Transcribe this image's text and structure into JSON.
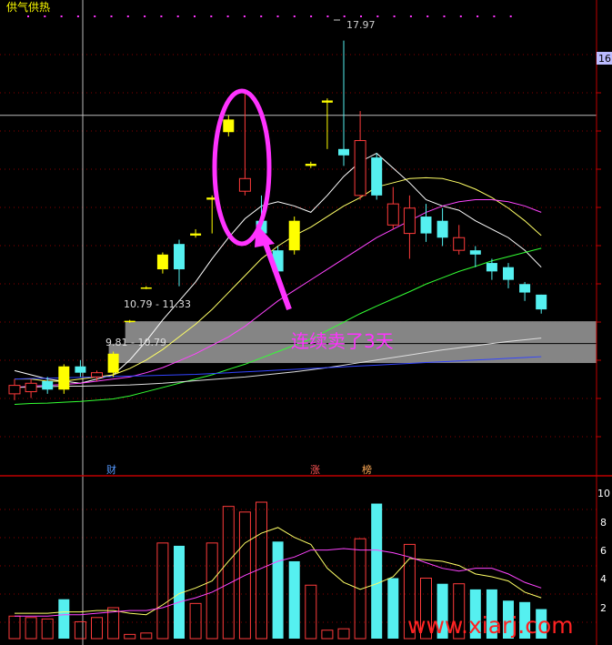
{
  "header": {
    "title": "供气供热",
    "title_color": "#ffff00"
  },
  "colors": {
    "up_candle": "#ff3b3b",
    "down_candle": "#55f0f0",
    "yellow_candle": "#ffff00",
    "ma5": "#ffffff",
    "ma10": "#ffff66",
    "ma20": "#ff44ff",
    "ma60": "#33ff33",
    "ma120": "#dddddd",
    "ma250": "#3344ff",
    "annotation": "#ff33ff",
    "grid": "#8a0000",
    "axis": "#c00000",
    "zone": "#8c8c8c"
  },
  "price_axis": {
    "tag": "16.",
    "ylim": [
      8.8,
      18.5
    ],
    "ticks": []
  },
  "volume_axis": {
    "ticks": [
      "10",
      "8",
      "6",
      "4",
      "2"
    ],
    "ylim": [
      0,
      10.8
    ]
  },
  "markers": [
    {
      "label": "财",
      "color": "#5599ff",
      "index": 7
    },
    {
      "label": "涨",
      "color": "#ff5555",
      "index": 21
    },
    {
      "label": "榜",
      "color": "#ffaa55",
      "index": 24
    }
  ],
  "annotation": {
    "text": "连续卖了3天"
  },
  "high_label": "17.97",
  "watermark": "www.xiarj.com",
  "chart_data": [
    {
      "type": "candlestick",
      "zones": [
        {
          "label": "10.79 - 11.33",
          "low": 10.79,
          "high": 11.33,
          "from_index": 7
        },
        {
          "label": "9.81 - 10.79",
          "low": 10.33,
          "high": 10.79,
          "from_index": 6
        }
      ],
      "reference_line": 16.2,
      "candles": [
        {
          "o": 9.6,
          "c": 9.8,
          "h": 9.95,
          "l": 9.45,
          "color": "up"
        },
        {
          "o": 9.65,
          "c": 9.85,
          "h": 9.95,
          "l": 9.5,
          "color": "up"
        },
        {
          "o": 9.9,
          "c": 9.7,
          "h": 10.0,
          "l": 9.6,
          "color": "down"
        },
        {
          "o": 9.7,
          "c": 10.25,
          "h": 10.3,
          "l": 9.6,
          "color": "yellow"
        },
        {
          "o": 10.25,
          "c": 10.1,
          "h": 10.4,
          "l": 10.0,
          "color": "down"
        },
        {
          "o": 10.0,
          "c": 10.1,
          "h": 10.15,
          "l": 9.9,
          "color": "up"
        },
        {
          "o": 10.1,
          "c": 10.55,
          "h": 10.6,
          "l": 10.0,
          "color": "yellow"
        },
        {
          "o": 11.31,
          "c": 11.33,
          "h": 11.35,
          "l": 11.28,
          "color": "yellow"
        },
        {
          "o": 12.1,
          "c": 12.12,
          "h": 12.15,
          "l": 12.08,
          "color": "yellow"
        },
        {
          "o": 12.55,
          "c": 12.9,
          "h": 12.95,
          "l": 12.45,
          "color": "yellow"
        },
        {
          "o": 13.15,
          "c": 12.55,
          "h": 13.25,
          "l": 12.15,
          "color": "down"
        },
        {
          "o": 13.35,
          "c": 13.4,
          "h": 13.5,
          "l": 13.3,
          "color": "yellow"
        },
        {
          "o": 14.2,
          "c": 14.25,
          "h": 14.3,
          "l": 13.4,
          "color": "yellow"
        },
        {
          "o": 15.8,
          "c": 16.1,
          "h": 16.2,
          "l": 15.7,
          "color": "yellow"
        },
        {
          "o": 14.7,
          "c": 14.4,
          "h": 16.8,
          "l": 14.3,
          "color": "up"
        },
        {
          "o": 13.7,
          "c": 13.4,
          "h": 14.3,
          "l": 13.3,
          "color": "down"
        },
        {
          "o": 13.0,
          "c": 12.5,
          "h": 13.1,
          "l": 12.4,
          "color": "down"
        },
        {
          "o": 13.7,
          "c": 13.0,
          "h": 13.8,
          "l": 12.9,
          "color": "yellow"
        },
        {
          "o": 15.0,
          "c": 15.05,
          "h": 15.1,
          "l": 14.95,
          "color": "yellow"
        },
        {
          "o": 16.5,
          "c": 16.55,
          "h": 16.6,
          "l": 15.4,
          "color": "yellow"
        },
        {
          "o": 15.4,
          "c": 15.25,
          "h": 17.97,
          "l": 15.0,
          "color": "down"
        },
        {
          "o": 14.3,
          "c": 15.6,
          "h": 16.3,
          "l": 14.2,
          "color": "up"
        },
        {
          "o": 15.2,
          "c": 14.3,
          "h": 15.3,
          "l": 14.2,
          "color": "down"
        },
        {
          "o": 13.6,
          "c": 14.1,
          "h": 14.5,
          "l": 13.5,
          "color": "up"
        },
        {
          "o": 13.4,
          "c": 14.0,
          "h": 14.3,
          "l": 12.8,
          "color": "up"
        },
        {
          "o": 13.8,
          "c": 13.4,
          "h": 14.1,
          "l": 13.2,
          "color": "down"
        },
        {
          "o": 13.7,
          "c": 13.3,
          "h": 14.0,
          "l": 13.1,
          "color": "down"
        },
        {
          "o": 13.0,
          "c": 13.3,
          "h": 13.6,
          "l": 12.9,
          "color": "up"
        },
        {
          "o": 13.0,
          "c": 12.9,
          "h": 13.1,
          "l": 12.6,
          "color": "down"
        },
        {
          "o": 12.7,
          "c": 12.5,
          "h": 12.8,
          "l": 12.3,
          "color": "down"
        },
        {
          "o": 12.6,
          "c": 12.3,
          "h": 12.7,
          "l": 12.1,
          "color": "down"
        },
        {
          "o": 12.2,
          "c": 12.0,
          "h": 12.25,
          "l": 11.8,
          "color": "down"
        },
        {
          "o": 11.95,
          "c": 11.6,
          "h": 11.95,
          "l": 11.5,
          "color": "down"
        }
      ],
      "moving_averages": [
        {
          "name": "MA5",
          "color": "#ffffff",
          "values": [
            10.15,
            10.05,
            9.95,
            9.9,
            9.85,
            9.95,
            10.05,
            10.4,
            10.85,
            11.35,
            11.8,
            12.25,
            12.8,
            13.3,
            13.75,
            14.05,
            14.15,
            14.05,
            13.9,
            14.3,
            14.75,
            15.1,
            15.3,
            14.95,
            14.6,
            14.2,
            14.05,
            13.95,
            13.7,
            13.5,
            13.3,
            13.0,
            12.6
          ]
        },
        {
          "name": "MA10",
          "color": "#ffff66",
          "values": [
            9.95,
            9.95,
            9.9,
            9.9,
            9.95,
            10.0,
            10.05,
            10.2,
            10.4,
            10.65,
            10.95,
            11.25,
            11.6,
            12.0,
            12.4,
            12.8,
            13.1,
            13.35,
            13.55,
            13.8,
            14.05,
            14.25,
            14.5,
            14.6,
            14.7,
            14.72,
            14.7,
            14.6,
            14.45,
            14.25,
            14.0,
            13.7,
            13.35
          ]
        },
        {
          "name": "MA20",
          "color": "#ff44ff",
          "values": [
            9.75,
            9.78,
            9.8,
            9.82,
            9.85,
            9.9,
            9.95,
            10.0,
            10.1,
            10.22,
            10.38,
            10.55,
            10.75,
            10.95,
            11.2,
            11.5,
            11.8,
            12.05,
            12.3,
            12.55,
            12.8,
            13.05,
            13.3,
            13.5,
            13.7,
            13.9,
            14.05,
            14.15,
            14.2,
            14.2,
            14.15,
            14.05,
            13.9
          ]
        },
        {
          "name": "MA60",
          "color": "#33ff33",
          "values": [
            9.35,
            9.37,
            9.38,
            9.4,
            9.42,
            9.45,
            9.48,
            9.55,
            9.65,
            9.75,
            9.85,
            9.95,
            10.05,
            10.18,
            10.3,
            10.45,
            10.6,
            10.75,
            10.9,
            11.1,
            11.3,
            11.5,
            11.68,
            11.85,
            12.02,
            12.2,
            12.35,
            12.5,
            12.62,
            12.75,
            12.85,
            12.95,
            13.05
          ]
        },
        {
          "name": "MA120",
          "color": "#dddddd",
          "values": [
            9.75,
            9.76,
            9.77,
            9.78,
            9.78,
            9.79,
            9.8,
            9.81,
            9.83,
            9.85,
            9.88,
            9.91,
            9.94,
            9.97,
            10.0,
            10.04,
            10.08,
            10.12,
            10.17,
            10.22,
            10.28,
            10.34,
            10.4,
            10.46,
            10.52,
            10.58,
            10.64,
            10.69,
            10.74,
            10.79,
            10.84,
            10.88,
            10.92
          ]
        },
        {
          "name": "MA250",
          "color": "#3344ff",
          "values": [
            9.95,
            9.96,
            9.97,
            9.98,
            9.99,
            10.0,
            10.01,
            10.02,
            10.03,
            10.04,
            10.05,
            10.06,
            10.08,
            10.1,
            10.12,
            10.14,
            10.16,
            10.18,
            10.2,
            10.22,
            10.24,
            10.26,
            10.28,
            10.3,
            10.32,
            10.34,
            10.36,
            10.38,
            10.4,
            10.42,
            10.44,
            10.46,
            10.48
          ]
        }
      ]
    },
    {
      "type": "bar",
      "volumes": [
        1.6,
        1.5,
        1.4,
        2.8,
        1.2,
        1.5,
        2.2,
        0.3,
        0.4,
        6.8,
        6.6,
        2.5,
        6.8,
        9.4,
        9.0,
        9.7,
        6.9,
        5.5,
        3.8,
        0.6,
        0.7,
        7.1,
        9.6,
        4.3,
        6.7,
        4.3,
        3.9,
        3.9,
        3.5,
        3.5,
        2.7,
        2.6,
        2.1
      ],
      "colors": [
        "up",
        "up",
        "up",
        "down",
        "up",
        "up",
        "up",
        "up",
        "up",
        "up",
        "down",
        "up",
        "up",
        "up",
        "up",
        "up",
        "down",
        "down",
        "up",
        "up",
        "up",
        "up",
        "down",
        "down",
        "up",
        "up",
        "down",
        "up",
        "down",
        "down",
        "down",
        "down",
        "down"
      ],
      "ma_volume": [
        {
          "name": "MAVOL5",
          "color": "#ffff66",
          "values": [
            1.8,
            1.8,
            1.8,
            1.9,
            1.9,
            2.0,
            2.0,
            1.8,
            1.7,
            2.4,
            3.2,
            3.6,
            4.1,
            5.5,
            6.8,
            7.5,
            7.9,
            7.2,
            6.7,
            5.0,
            4.0,
            3.5,
            3.9,
            4.4,
            5.7,
            5.6,
            5.5,
            5.2,
            4.6,
            4.4,
            4.1,
            3.3,
            2.9
          ]
        },
        {
          "name": "MAVOL10",
          "color": "#ff44ff",
          "values": [
            1.6,
            1.6,
            1.6,
            1.7,
            1.7,
            1.8,
            1.9,
            2.0,
            2.0,
            2.2,
            2.6,
            2.9,
            3.3,
            3.9,
            4.5,
            5.0,
            5.5,
            5.8,
            6.3,
            6.3,
            6.4,
            6.3,
            6.3,
            6.1,
            5.8,
            5.4,
            5.0,
            4.8,
            5.0,
            5.0,
            4.6,
            4.0,
            3.6
          ]
        }
      ]
    }
  ]
}
